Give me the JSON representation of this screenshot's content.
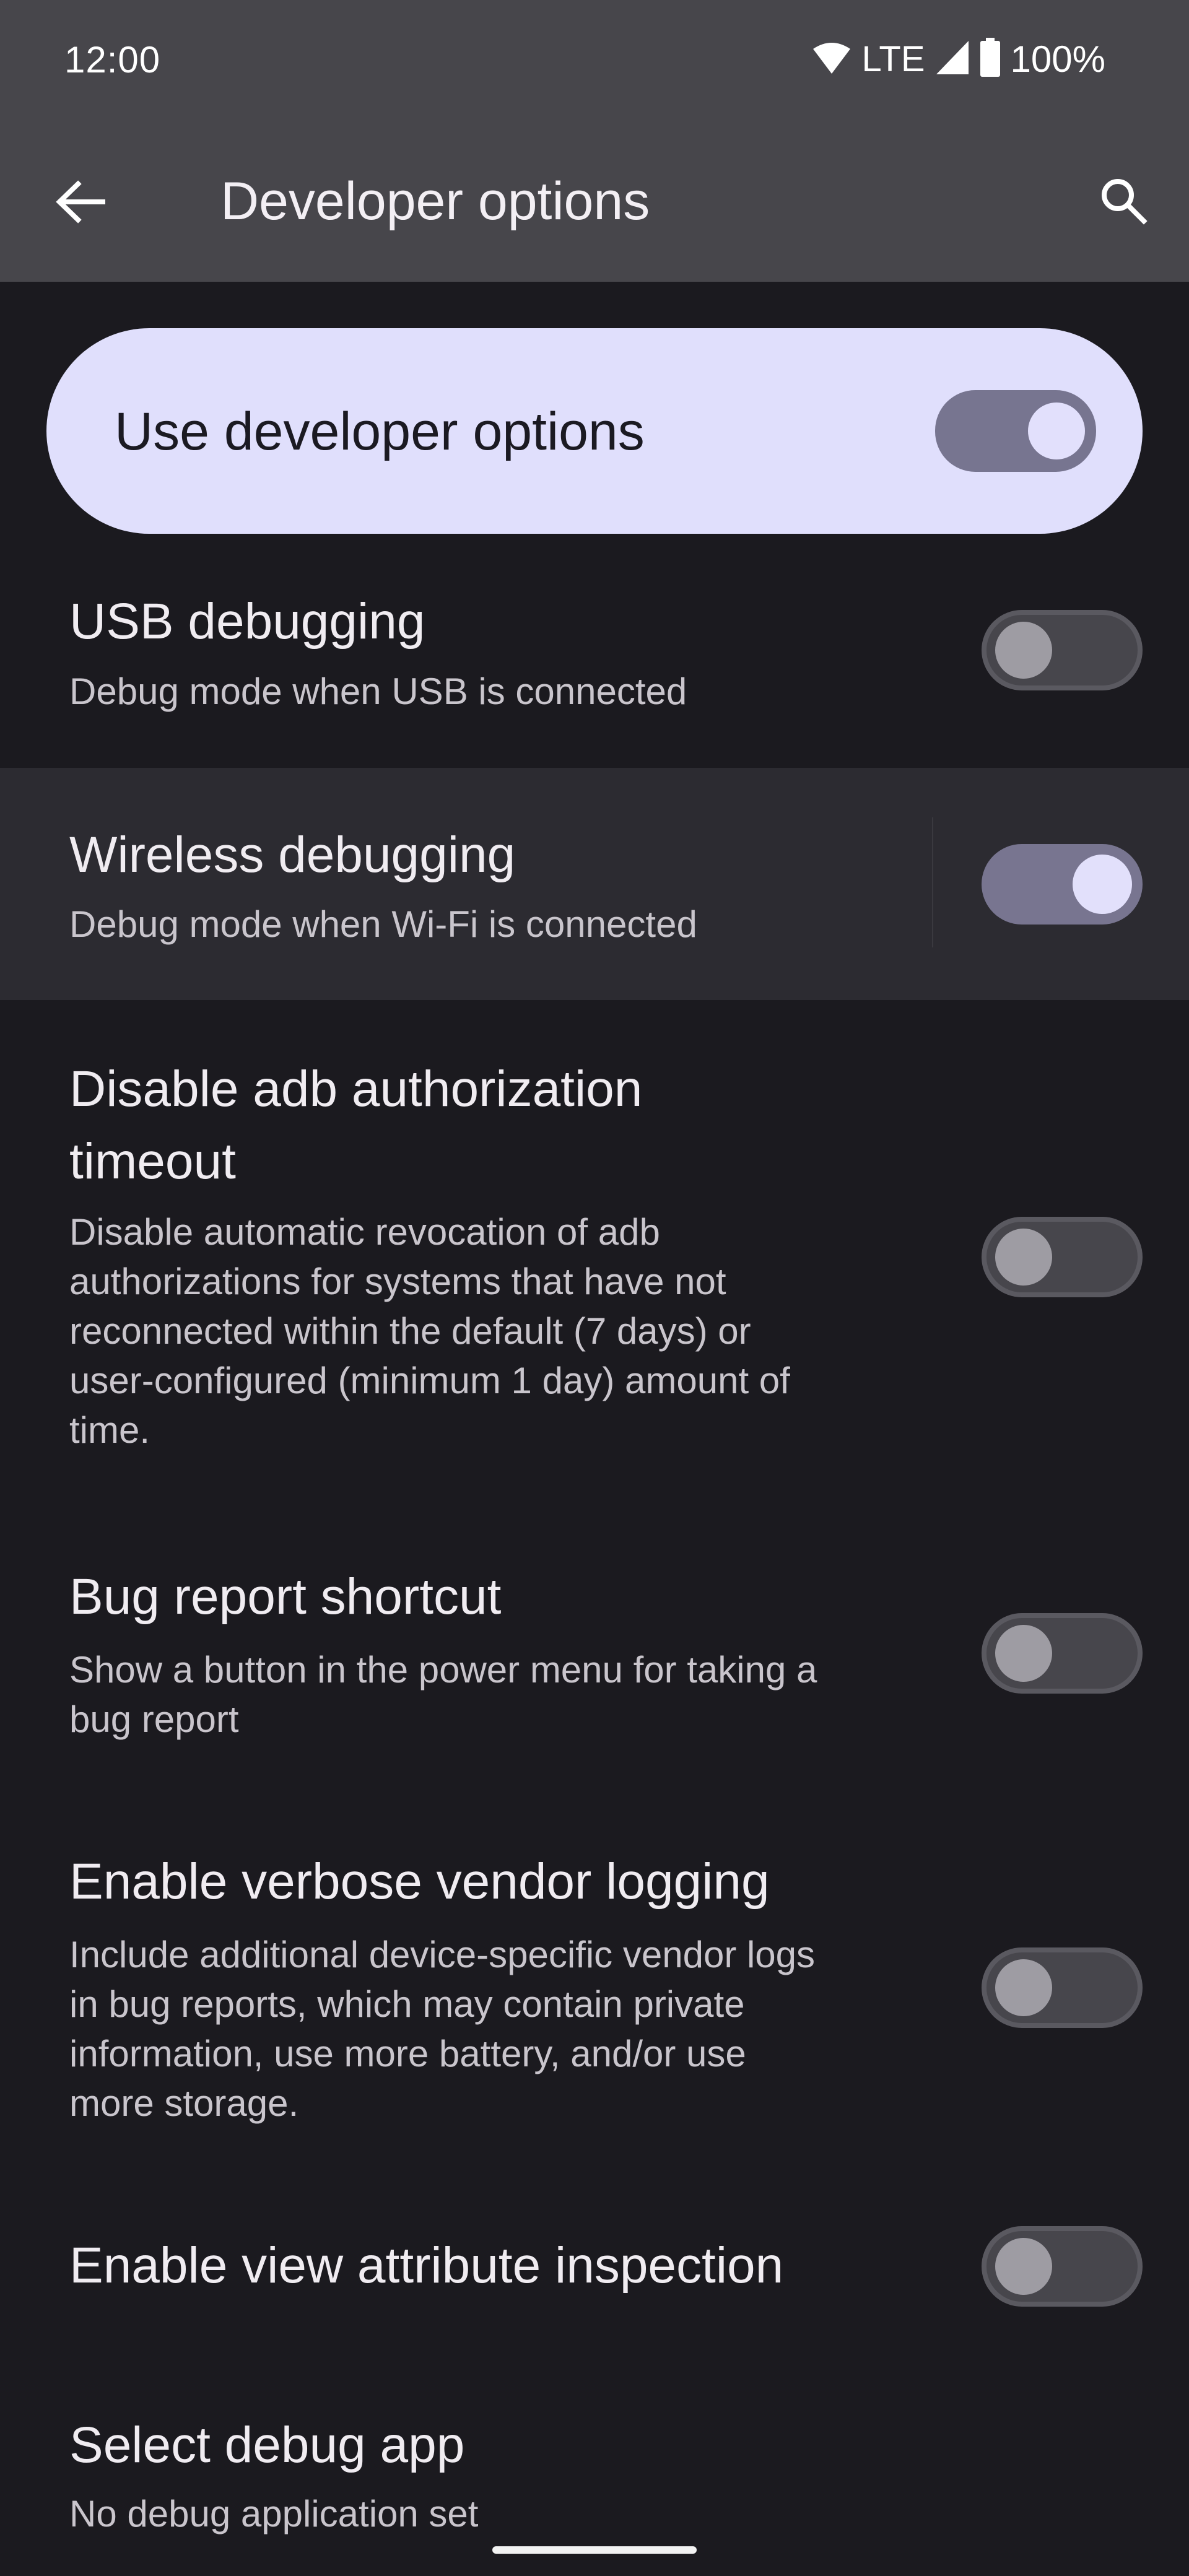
{
  "status_bar": {
    "time": "12:00",
    "network": "LTE",
    "battery": "100%",
    "icons": [
      "wifi-icon",
      "cell-signal-icon",
      "battery-icon"
    ]
  },
  "app_bar": {
    "title": "Developer options",
    "back_icon": "arrow-back-icon",
    "search_icon": "search-icon"
  },
  "master_switch": {
    "label": "Use developer options",
    "enabled": true
  },
  "settings": [
    {
      "title": "USB debugging",
      "subtitle": [
        "Debug mode when USB is connected"
      ],
      "enabled": false
    },
    {
      "title": "Wireless debugging",
      "subtitle": [
        "Debug mode when Wi-Fi is connected"
      ],
      "enabled": true,
      "highlighted": true
    },
    {
      "title": [
        "Disable adb authorization",
        "timeout"
      ],
      "subtitle": [
        "Disable automatic revocation of adb",
        "authorizations for systems that have not",
        "reconnected within the default (7 days) or",
        "user-configured (minimum 1 day) amount of",
        "time."
      ],
      "enabled": false
    },
    {
      "title": "Bug report shortcut",
      "subtitle": [
        "Show a button in the power menu for taking a",
        "bug report"
      ],
      "enabled": false
    },
    {
      "title": "Enable verbose vendor logging",
      "subtitle": [
        "Include additional device-specific vendor logs",
        "in bug reports, which may contain private",
        "information, use more battery, and/or use",
        "more storage."
      ],
      "enabled": false
    },
    {
      "title": "Enable view attribute inspection",
      "enabled": false
    },
    {
      "title": "Select debug app",
      "subtitle": [
        "No debug application set"
      ]
    }
  ],
  "colors": {
    "app_bar_bg": "#47464b",
    "page_bg": "#1b1a1f",
    "master_card_bg": "#e0dffc",
    "toggle_on_track": "#787590",
    "toggle_on_thumb": "#e2e0fb",
    "toggle_off_track": "#47464c",
    "toggle_off_thumb": "#9e9ca3",
    "highlight_row_bg": "#2c2b31"
  }
}
